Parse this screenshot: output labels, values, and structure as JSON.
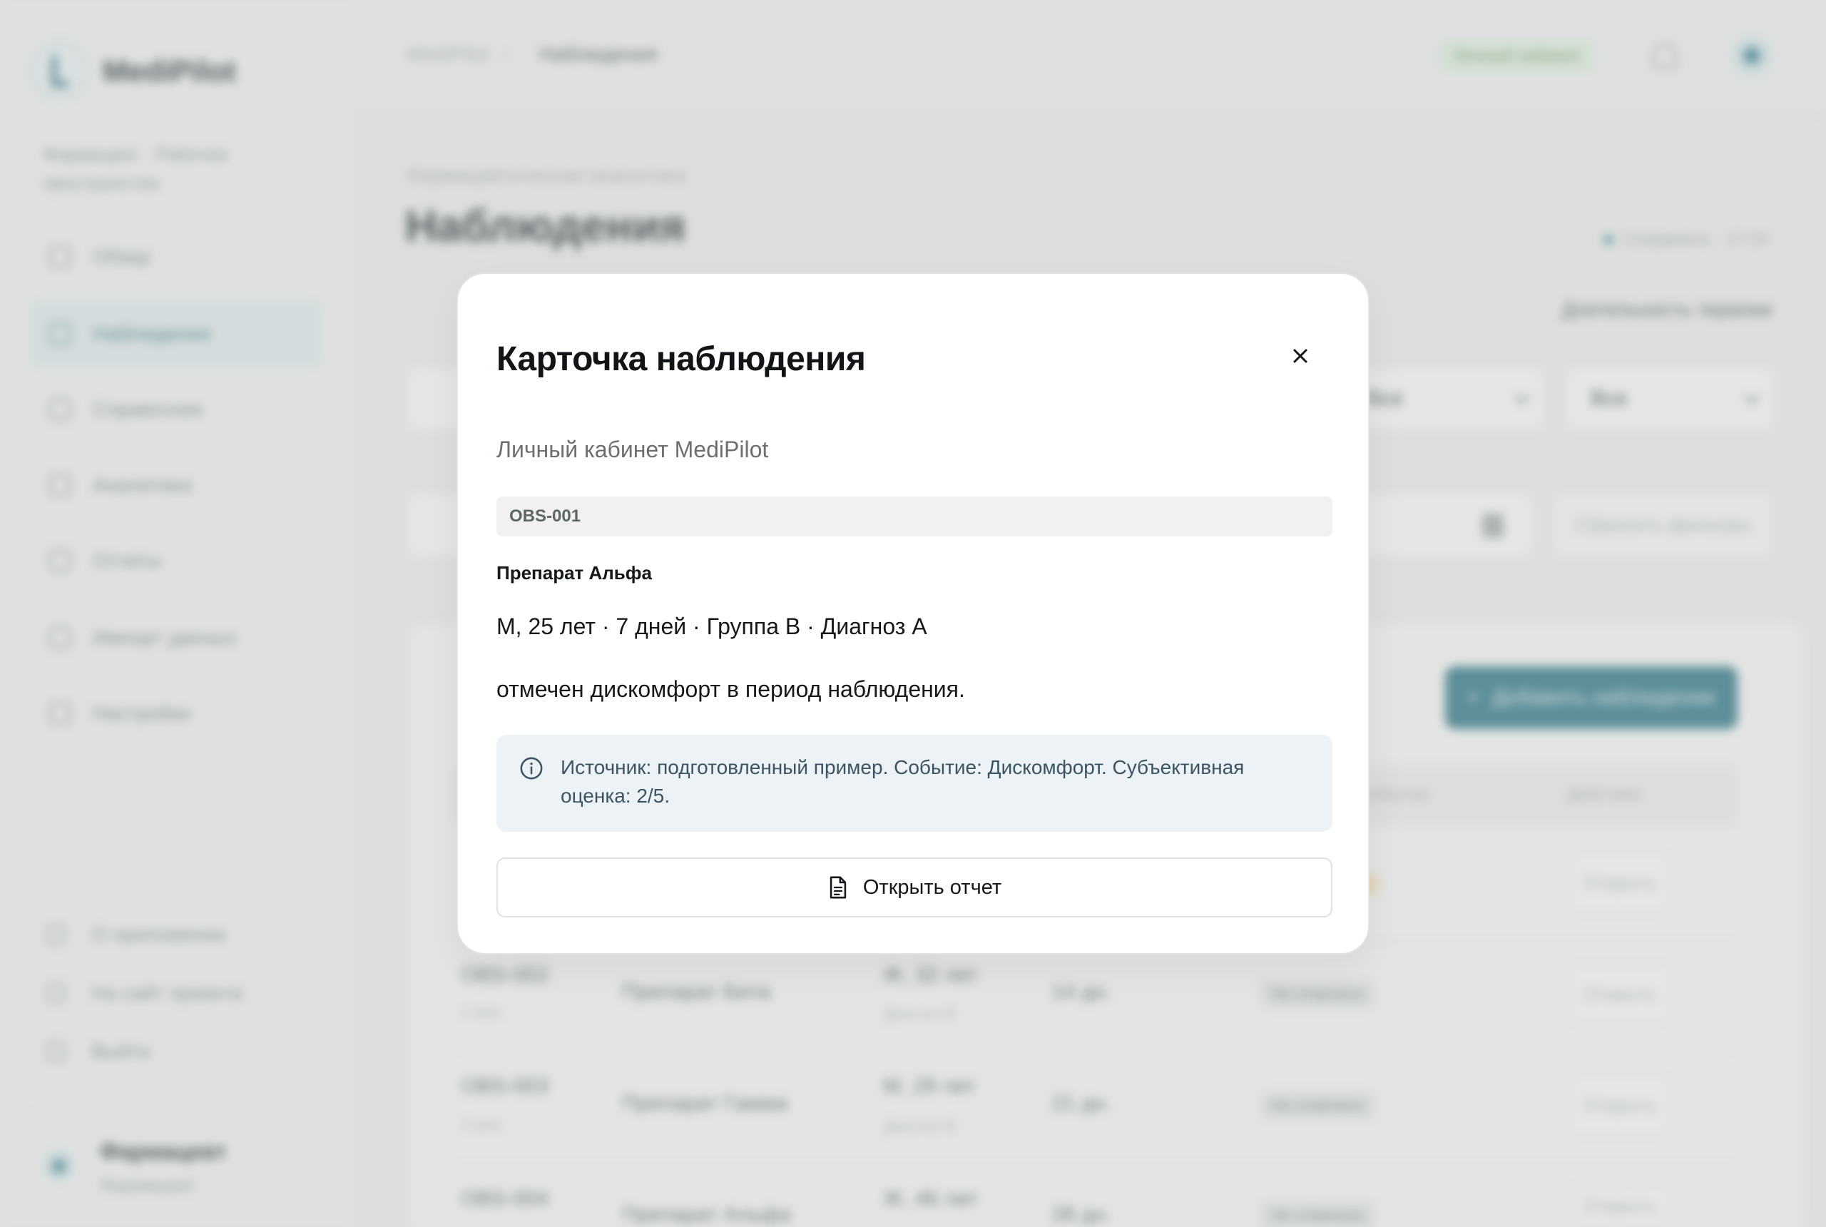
{
  "background": {
    "brand": "MediPilot",
    "workspace": "Фармацевт · Рабочее пространство",
    "nav": [
      {
        "label": "Обзор",
        "icon": "grid-icon"
      },
      {
        "label": "Наблюдения",
        "icon": "list-icon"
      },
      {
        "label": "Справочник",
        "icon": "chart-icon"
      },
      {
        "label": "Аналитика",
        "icon": "analytics-icon"
      },
      {
        "label": "Отчеты",
        "icon": "user-icon"
      },
      {
        "label": "Импорт данных",
        "icon": "import-icon"
      },
      {
        "label": "Настройки",
        "icon": "gear-icon"
      }
    ],
    "footer_nav": [
      {
        "label": "О приложении",
        "icon": "phone-icon"
      },
      {
        "label": "На сайт проекта",
        "icon": "sparkle-icon"
      },
      {
        "label": "Выйти",
        "icon": "logout-icon"
      }
    ],
    "user": {
      "name": "Фармацевт",
      "role": "Фармацевт"
    },
    "breadcrumb": [
      "MediPilot",
      "Наблюдения"
    ],
    "status_pill": "Личный кабинет",
    "page_subtitle": "Фармацевтическая аналитика",
    "page_title": "Наблюдения",
    "synced": "Сохранено · 17:24",
    "filters": {
      "duration_label": "Длительность терапии",
      "duration_value": "Все",
      "event_value": "Все",
      "reset_label": "Сбросить фильтры"
    },
    "add_button": "Добавить наблюдение",
    "columns": [
      "события",
      "Действия"
    ],
    "rows": [
      {
        "id": "OBS-002",
        "sub": "2 мин",
        "drug": "Препарат Бета",
        "patient": "Ж, 32 лет",
        "patient_sub": "Диагноз В",
        "dose": "14 дн.",
        "tag": "Не отмечено",
        "action": "Открыть"
      },
      {
        "id": "OBS-003",
        "sub": "3 мин",
        "drug": "Препарат Гамма",
        "patient": "М, 29 лет",
        "patient_sub": "Диагноз В",
        "dose": "21 дн.",
        "tag": "Не отмечено",
        "action": "Открыть"
      },
      {
        "id": "OBS-004",
        "sub": "",
        "drug": "Препарат Альфа",
        "patient": "Ж, 46 лет",
        "patient_sub": "",
        "dose": "28 дн.",
        "tag": "Не отмечено",
        "action": "Открыть"
      }
    ],
    "first_row_action": "Открыть"
  },
  "modal": {
    "title": "Карточка наблюдения",
    "subtitle": "Личный кабинет MediPilot",
    "observation_id": "OBS-001",
    "drug": "Препарат Альфа",
    "patient_info": "М, 25 лет · 7 дней · Группа B · Диагноз A",
    "observation_text": "отмечен дискомфорт в период наблюдения.",
    "info_note": "Источник: подготовленный пример. Событие: Дискомфорт. Субъективная оценка: 2/5.",
    "report_button": "Открыть отчет"
  }
}
